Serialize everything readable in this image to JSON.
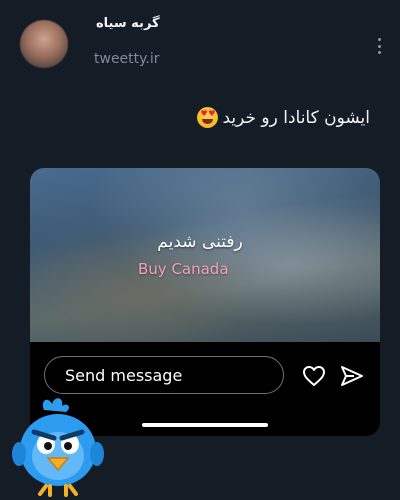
{
  "post": {
    "author_name": "گربه سیاه",
    "handle": "tweetty.ir",
    "text": "ایشون کانادا رو خرید",
    "emoji": "heart-eyes-emoji"
  },
  "media": {
    "caption_fa": "رفتنی شدیم",
    "caption_en": "Buy Canada"
  },
  "message_bar": {
    "input_value": "Send message",
    "like_icon": "heart-icon",
    "send_icon": "send-icon"
  },
  "colors": {
    "background": "#141c26",
    "caption_accent": "#f6a0b7",
    "mascot": "#2d9cf0"
  }
}
